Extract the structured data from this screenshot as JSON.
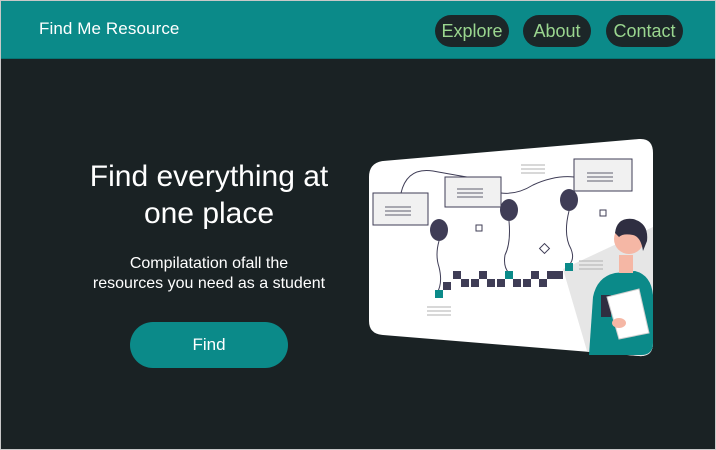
{
  "nav": {
    "brand": "Find Me Resource",
    "links": [
      {
        "label": "Explore"
      },
      {
        "label": "About"
      },
      {
        "label": "Contact"
      }
    ]
  },
  "hero": {
    "title_line1": "Find everything at",
    "title_line2": "one place",
    "subtitle_line1": "Compilatation ofall the",
    "subtitle_line2": "resources you need as a student",
    "button_label": "Find"
  },
  "colors": {
    "navbar": "#0b8a89",
    "background": "#1a2224",
    "nav_link_text": "#9ad68f",
    "button": "#0b8a89"
  },
  "illustration": {
    "icon": "student-resources-illustration"
  }
}
